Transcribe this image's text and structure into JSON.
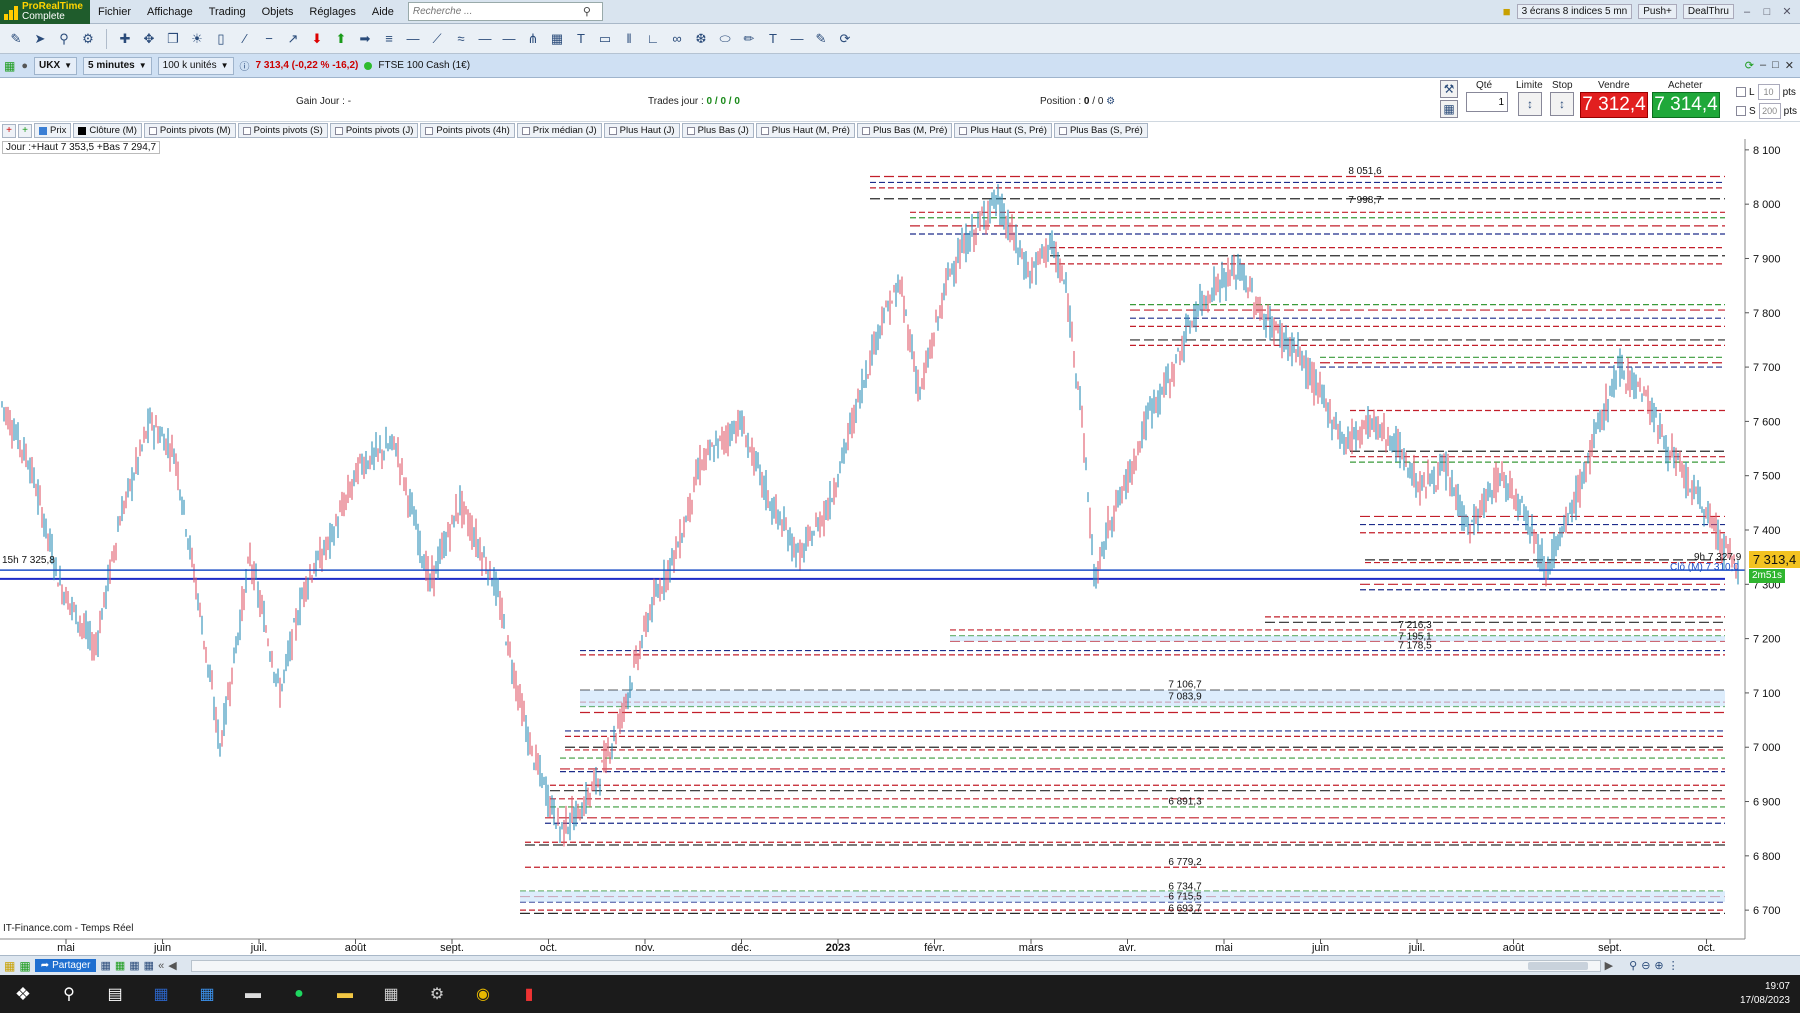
{
  "app": {
    "logo_line1": "ProRealTime",
    "logo_line2": "Complete"
  },
  "menu": [
    "Fichier",
    "Affichage",
    "Trading",
    "Objets",
    "Réglages",
    "Aide"
  ],
  "search": {
    "placeholder": "Recherche ..."
  },
  "menubar_right": {
    "layout_label": "3 écrans 8 indices 5 mn",
    "push_label": "Push+",
    "dealthru_label": "DealThru"
  },
  "chart_header": {
    "ticker": "UKX",
    "timeframe": "5 minutes",
    "units": "100 k unités",
    "quote": "7 313,4 (-0,22 % -16,2)",
    "instrument": "FTSE 100 Cash (1€)"
  },
  "info": {
    "gain_label": "Gain Jour :",
    "gain_value": "-",
    "trades_label": "Trades jour :",
    "trades_value": "0 / 0 / 0",
    "position_label": "Position :",
    "position_value": "0",
    "position_value2": "/ 0"
  },
  "order": {
    "qty_label": "Qté",
    "qty_value": "1",
    "limit_label": "Limite",
    "stop_label": "Stop",
    "sell_label": "Vendre",
    "buy_label": "Acheter",
    "sell_price": "7 312,4",
    "buy_price": "7 314,4",
    "l_label": "L",
    "l_pts": "10",
    "s_label": "S",
    "s_pts": "200",
    "pts_unit": "pts"
  },
  "indicators": [
    {
      "label": "Prix",
      "color": "#3b7fd4"
    },
    {
      "label": "Clôture (M)",
      "color": "#000000"
    },
    {
      "label": "Points pivots (M)",
      "color": ""
    },
    {
      "label": "Points pivots (S)",
      "color": ""
    },
    {
      "label": "Points pivots (J)",
      "color": ""
    },
    {
      "label": "Points pivots (4h)",
      "color": ""
    },
    {
      "label": "Prix médian (J)",
      "color": ""
    },
    {
      "label": "Plus Haut (J)",
      "color": ""
    },
    {
      "label": "Plus Bas (J)",
      "color": ""
    },
    {
      "label": "Plus Haut (M, Pré)",
      "color": ""
    },
    {
      "label": "Plus Bas (M, Pré)",
      "color": ""
    },
    {
      "label": "Plus Haut (S, Pré)",
      "color": ""
    },
    {
      "label": "Plus Bas (S, Pré)",
      "color": ""
    }
  ],
  "chart": {
    "day_label": "Jour :+Haut 7 353,5 +Bas 7 294,7",
    "source": "IT-Finance.com - Temps Réel",
    "left_marker": "15h 7 325,8",
    "right_marker": "9h 7 327,9",
    "close_marker": "Clô (M) 7 310,0",
    "last_price": "7 313,4",
    "countdown": "2m51s"
  },
  "chart_data": {
    "type": "candlestick",
    "y_ticks": [
      "8 100",
      "8 000",
      "7 900",
      "7 800",
      "7 700",
      "7 600",
      "7 500",
      "7 400",
      "7 300",
      "7 200",
      "7 100",
      "7 000",
      "6 900",
      "6 800",
      "6 700"
    ],
    "ylim": [
      6680,
      8120
    ],
    "x_ticks": [
      "mai",
      "juin",
      "juil.",
      "août",
      "sept.",
      "oct.",
      "nov.",
      "déc.",
      "2023",
      "févr.",
      "mars",
      "avr.",
      "mai",
      "juin",
      "juil.",
      "août",
      "sept.",
      "oct."
    ],
    "level_labels": [
      {
        "label": "8 051,6",
        "value": 8051.6
      },
      {
        "label": "7 998,7",
        "value": 7998.7
      },
      {
        "label": "7 216,3",
        "value": 7216.3
      },
      {
        "label": "7 195,1",
        "value": 7195.1
      },
      {
        "label": "7 178,5",
        "value": 7178.5
      },
      {
        "label": "7 106,7",
        "value": 7106.7
      },
      {
        "label": "7 083,9",
        "value": 7083.9
      },
      {
        "label": "6 891,3",
        "value": 6891.3
      },
      {
        "label": "6 779,2",
        "value": 6779.2
      },
      {
        "label": "6 734,7",
        "value": 6734.7
      },
      {
        "label": "6 715,5",
        "value": 6715.5
      },
      {
        "label": "6 693,7",
        "value": 6693.7
      }
    ]
  },
  "bottom": {
    "share_label": "Partager"
  },
  "taskbar": {
    "time": "19:07",
    "date": "17/08/2023"
  }
}
